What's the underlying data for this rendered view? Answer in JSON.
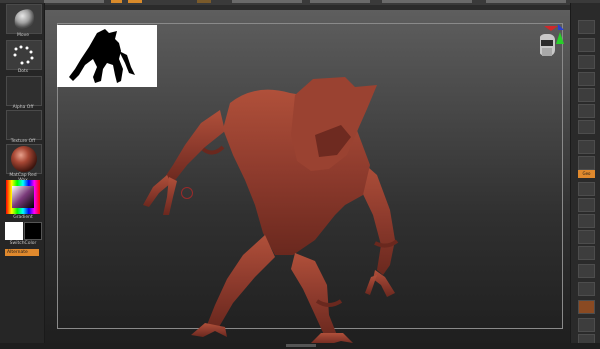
{
  "left_shelf": {
    "brush_label": "Move",
    "stroke_label": "Dots",
    "alpha_label": "Alpha Off",
    "texture_label": "Texture Off",
    "material_label": "MatCap Red Wax",
    "gradient_label": "Gradient",
    "switch_color_label": "SwitchColor",
    "alternate_label": "Alternate"
  },
  "right_shelf": {
    "active_button_label": "Geo"
  },
  "colors": {
    "accent_orange": "#e0892d",
    "model_red": "#8e3b2d"
  }
}
